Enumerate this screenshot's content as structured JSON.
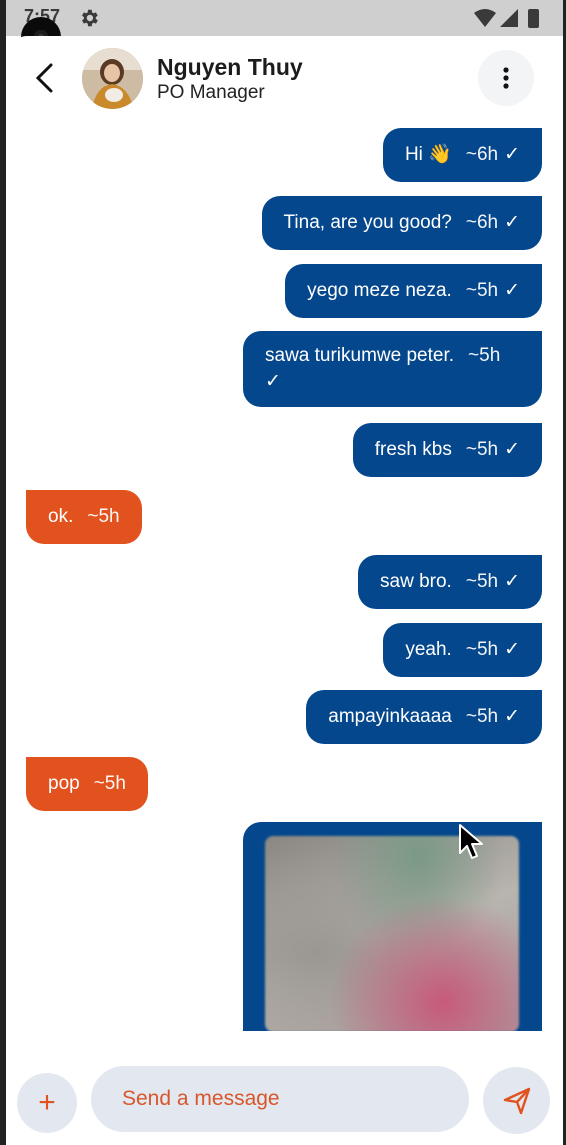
{
  "status_bar": {
    "time": "7:57"
  },
  "header": {
    "contact_name": "Nguyen Thuy",
    "contact_role": "PO Manager"
  },
  "messages": [
    {
      "direction": "out",
      "text": "Hi 👋",
      "time": "~6h",
      "tick": "✓"
    },
    {
      "direction": "out",
      "text": "Tina, are you good?",
      "time": "~6h",
      "tick": "✓"
    },
    {
      "direction": "out",
      "text": "yego meze neza.",
      "time": "~5h",
      "tick": "✓"
    },
    {
      "direction": "out",
      "text": "sawa turikumwe peter.",
      "time": "~5h",
      "tick": "✓"
    },
    {
      "direction": "out",
      "text": "fresh kbs",
      "time": "~5h",
      "tick": "✓"
    },
    {
      "direction": "in",
      "text": "ok.",
      "time": "~5h"
    },
    {
      "direction": "out",
      "text": "saw bro.",
      "time": "~5h",
      "tick": "✓"
    },
    {
      "direction": "out",
      "text": "yeah.",
      "time": "~5h",
      "tick": "✓"
    },
    {
      "direction": "out",
      "text": "ampayinkaaaa",
      "time": "~5h",
      "tick": "✓"
    },
    {
      "direction": "in",
      "text": "pop",
      "time": "~5h"
    }
  ],
  "composer": {
    "placeholder": "Send a message",
    "add_label": "+"
  },
  "colors": {
    "outgoing_bubble": "#05478c",
    "incoming_bubble": "#e2521f",
    "accent": "#e2521f",
    "input_bg": "#e3e8f0"
  }
}
